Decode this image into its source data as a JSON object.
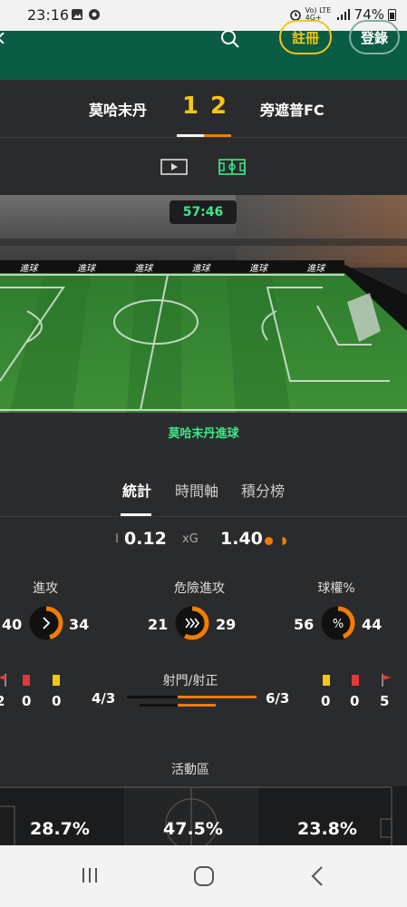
{
  "status_bar": {
    "time": "23:16",
    "network_label": "Vo) LTE 4G+",
    "battery": "74%"
  },
  "header": {
    "register_label": "註冊",
    "login_label": "登錄"
  },
  "match": {
    "home_team": "莫哈末丹",
    "away_team": "旁遮普FC",
    "home_score": "1",
    "away_score": "2"
  },
  "animation": {
    "clock": "57:46",
    "board_text": "進球",
    "event_text": "莫哈末丹進球"
  },
  "tabs": [
    {
      "label": "統計"
    },
    {
      "label": "時間軸"
    },
    {
      "label": "積分榜"
    }
  ],
  "xg": {
    "label": "xG",
    "home": "0.12",
    "away": "1.40"
  },
  "stats": {
    "attacks": {
      "label": "進攻",
      "home": "40",
      "away": "34"
    },
    "dangerous_attacks": {
      "label": "危險進攻",
      "home": "21",
      "away": "29"
    },
    "possession": {
      "label": "球權%",
      "home": "56",
      "away": "44"
    }
  },
  "cards": {
    "home": {
      "corners": "2",
      "red": "0",
      "yellow": "0"
    },
    "away": {
      "yellow": "0",
      "red": "0",
      "corners": "5"
    }
  },
  "shots": {
    "label": "射門/射正",
    "home": "4/3",
    "away": "6/3"
  },
  "activity": {
    "label": "活動區",
    "left": "28.7%",
    "middle": "47.5%",
    "right": "23.8%"
  },
  "colors": {
    "brand_green": "#0b5c45",
    "accent_yellow": "#f5c518",
    "accent_orange": "#f07d00",
    "event_green": "#3ee88a"
  }
}
